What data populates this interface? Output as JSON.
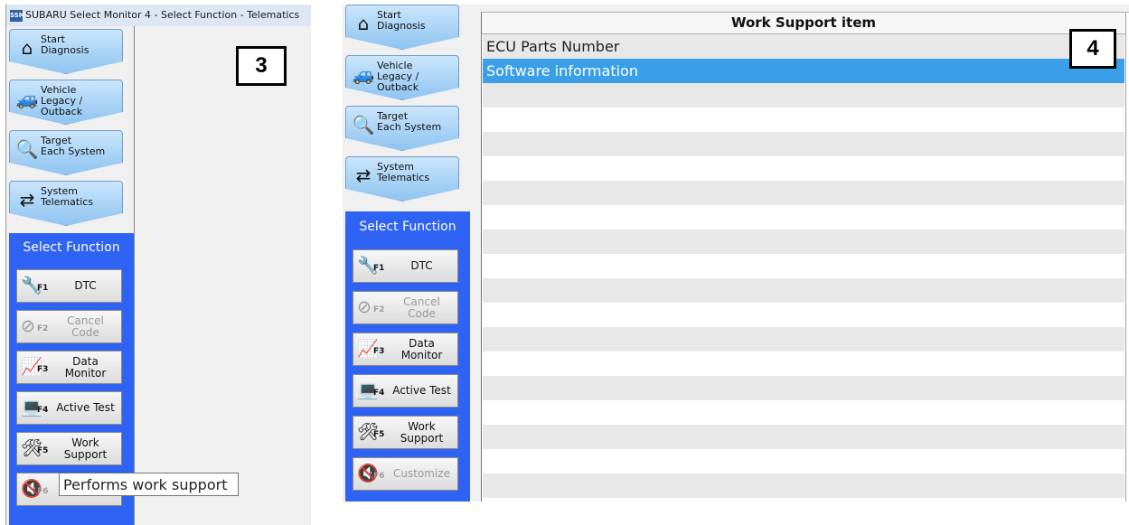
{
  "panel3": {
    "window_title": "SUBARU Select Monitor 4 - Select Function - Telematics",
    "app_icon_text": "SSM",
    "marker": "3",
    "nav": [
      {
        "icon": "home-icon",
        "label": "Start\nDiagnosis"
      },
      {
        "icon": "vehicle-icon",
        "label": "Vehicle\nLegacy /\nOutback"
      },
      {
        "icon": "target-icon",
        "label": "Target\nEach System"
      },
      {
        "icon": "system-icon",
        "label": "System\nTelematics"
      }
    ],
    "select_function_title": "Select Function",
    "functions": [
      {
        "key": "F1",
        "label": "DTC",
        "enabled": true,
        "icon": "dtc-icon"
      },
      {
        "key": "F2",
        "label": "Cancel Code",
        "enabled": false,
        "icon": "cancel-code-icon"
      },
      {
        "key": "F3",
        "label": "Data Monitor",
        "enabled": true,
        "icon": "data-monitor-icon"
      },
      {
        "key": "F4",
        "label": "Active Test",
        "enabled": true,
        "icon": "active-test-icon"
      },
      {
        "key": "F5",
        "label": "Work\nSupport",
        "enabled": true,
        "icon": "work-support-icon"
      },
      {
        "key": "F6",
        "label": "",
        "enabled": false,
        "icon": "customize-icon"
      }
    ],
    "tooltip": "Performs work support"
  },
  "panel4": {
    "marker": "4",
    "nav": [
      {
        "icon": "home-icon",
        "label": "Start\nDiagnosis"
      },
      {
        "icon": "vehicle-icon",
        "label": "Vehicle\nLegacy /\nOutback"
      },
      {
        "icon": "target-icon",
        "label": "Target\nEach System"
      },
      {
        "icon": "system-icon",
        "label": "System\nTelematics"
      }
    ],
    "select_function_title": "Select Function",
    "functions": [
      {
        "key": "F1",
        "label": "DTC",
        "enabled": true,
        "icon": "dtc-icon"
      },
      {
        "key": "F2",
        "label": "Cancel Code",
        "enabled": false,
        "icon": "cancel-code-icon"
      },
      {
        "key": "F3",
        "label": "Data Monitor",
        "enabled": true,
        "icon": "data-monitor-icon"
      },
      {
        "key": "F4",
        "label": "Active Test",
        "enabled": true,
        "icon": "active-test-icon"
      },
      {
        "key": "F5",
        "label": "Work\nSupport",
        "enabled": true,
        "icon": "work-support-icon"
      },
      {
        "key": "F6",
        "label": "Customize",
        "enabled": false,
        "icon": "customize-icon"
      }
    ],
    "table": {
      "header": "Work Support item",
      "rows": [
        "ECU Parts Number",
        "Software information"
      ],
      "selected_index": 1
    }
  },
  "colors": {
    "select_function_bg": "#2f63f4",
    "selected_row": "#3a9fe8",
    "nav_button": "#a9d3f5"
  }
}
